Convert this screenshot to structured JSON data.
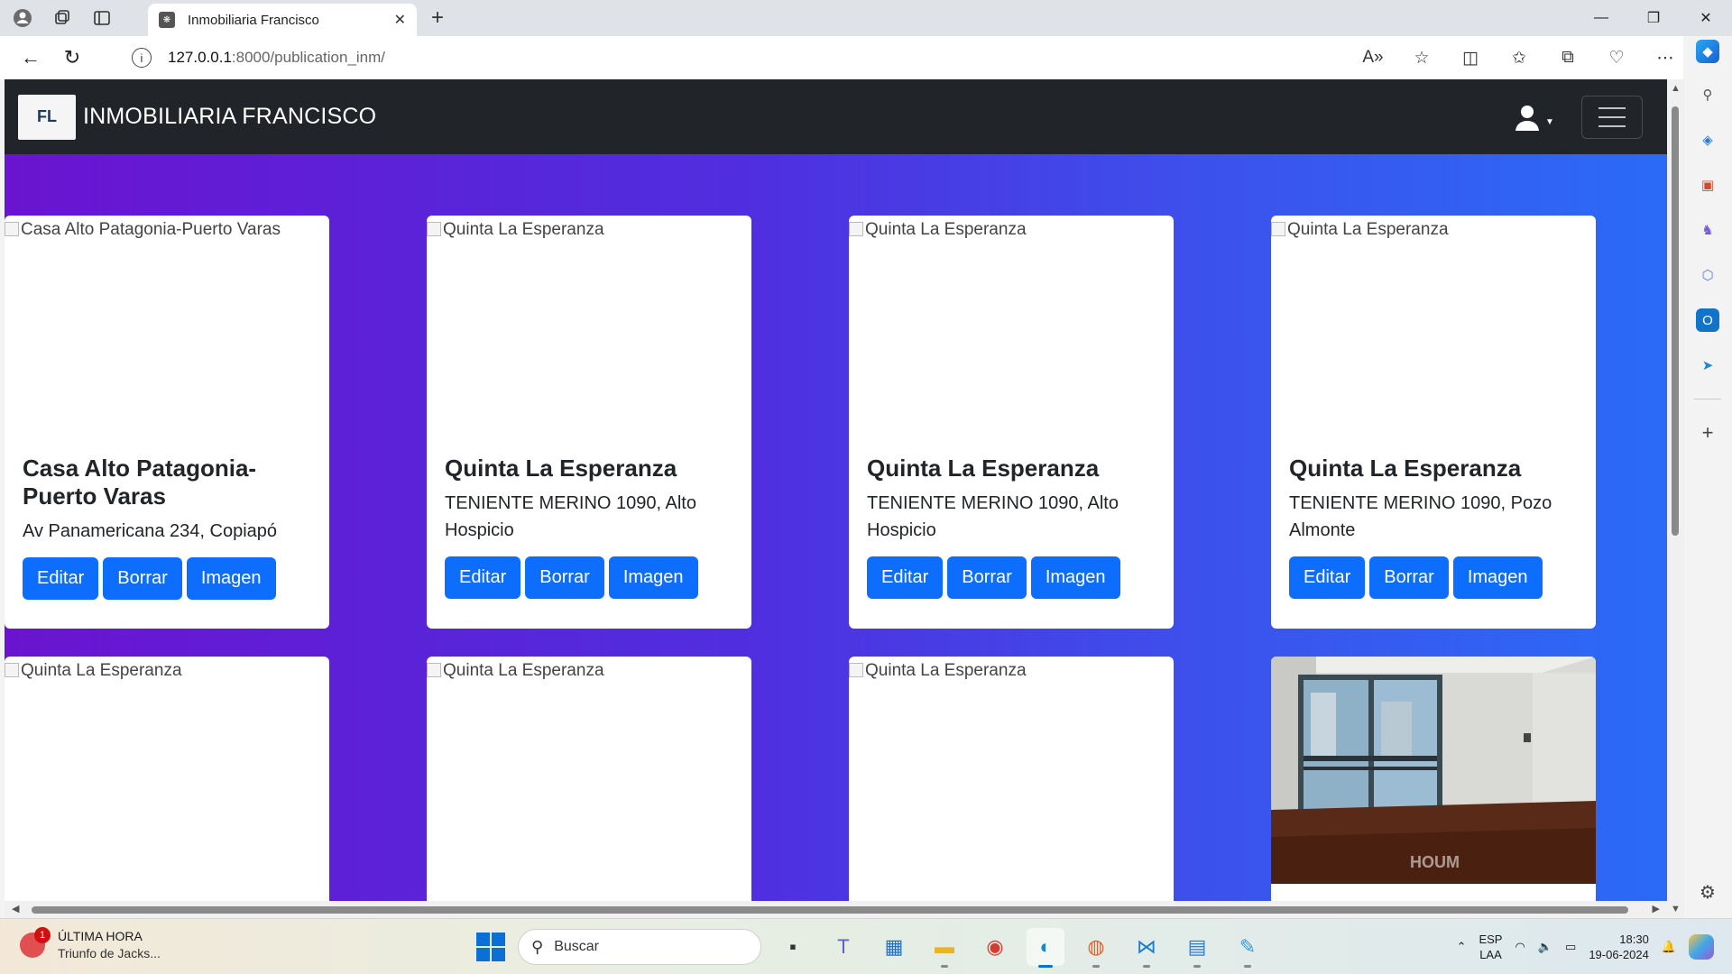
{
  "browser": {
    "tab_title": "Inmobiliaria Francisco",
    "url_host": "127.0.0.1",
    "url_rest": ":8000/publication_inm/"
  },
  "site": {
    "brand": "INMOBILIARIA FRANCISCO",
    "logo_text": "FL"
  },
  "cards": [
    {
      "alt": "Casa Alto Patagonia-Puerto Varas",
      "title": "Casa Alto Patagonia-Puerto Varas",
      "address": "Av Panamericana 234, Copiapó",
      "edit": "Editar",
      "delete": "Borrar",
      "image": "Imagen"
    },
    {
      "alt": "Quinta La Esperanza",
      "title": "Quinta La Esperanza",
      "address": "TENIENTE MERINO 1090, Alto Hospicio",
      "edit": "Editar",
      "delete": "Borrar",
      "image": "Imagen"
    },
    {
      "alt": "Quinta La Esperanza",
      "title": "Quinta La Esperanza",
      "address": "TENIENTE MERINO 1090, Alto Hospicio",
      "edit": "Editar",
      "delete": "Borrar",
      "image": "Imagen"
    },
    {
      "alt": "Quinta La Esperanza",
      "title": "Quinta La Esperanza",
      "address": "TENIENTE MERINO 1090, Pozo Almonte",
      "edit": "Editar",
      "delete": "Borrar",
      "image": "Imagen"
    },
    {
      "alt": "Quinta La Esperanza"
    },
    {
      "alt": "Quinta La Esperanza"
    },
    {
      "alt": "Quinta La Esperanza"
    },
    {
      "watermark": "HOUM"
    }
  ],
  "taskbar": {
    "news_title": "ÚLTIMA HORA",
    "news_sub": "Triunfo de Jacks...",
    "news_badge": "1",
    "search_placeholder": "Buscar",
    "lang1": "ESP",
    "lang2": "LAA",
    "time": "18:30",
    "date": "19-06-2024"
  },
  "colors": {
    "primary_button": "#0d6efd",
    "navbar": "#212529",
    "gradient_start": "#6a14cf",
    "gradient_end": "#2a6bf7"
  }
}
